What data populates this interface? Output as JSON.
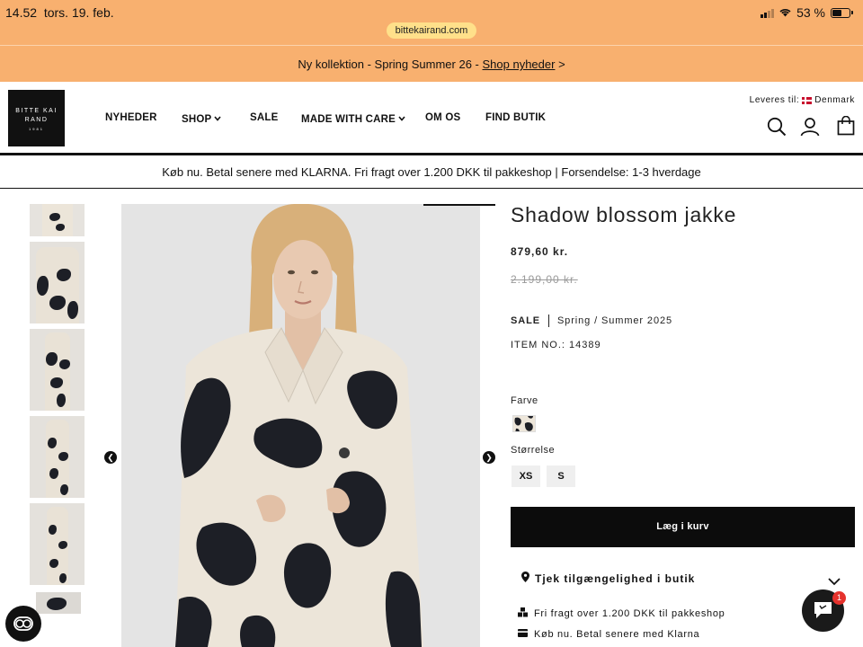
{
  "status_bar": {
    "time": "14.52",
    "date": "tors. 19. feb.",
    "battery": "53 %",
    "battery_level": 0.53,
    "url": "bittekairand.com"
  },
  "promo": {
    "text": "Ny kollektion - Spring Summer 26 - ",
    "link": "Shop nyheder",
    "arrow": " >"
  },
  "header": {
    "logo_line1": "BITTE KAI",
    "logo_line2": "RAND",
    "logo_year": "1981",
    "nav": [
      {
        "label": "NYHEDER"
      },
      {
        "label": "SHOP"
      },
      {
        "label": "SALE"
      },
      {
        "label": "MADE WITH CARE"
      },
      {
        "label": "OM OS"
      },
      {
        "label": "FIND BUTIK"
      }
    ],
    "delivery_label": "Leveres til:",
    "delivery_country": "Denmark"
  },
  "info_bar": "Køb nu. Betal senere med KLARNA. Fri fragt over 1.200 DKK til pakkeshop | Forsendelse: 1-3 hverdage",
  "product": {
    "title": "Shadow blossom jakke",
    "price": "879,60 kr.",
    "old_price": "2.199,00 kr.",
    "sale_tag": "SALE",
    "season": "Spring / Summer 2025",
    "item_no": "ITEM NO.: 14389",
    "color_label": "Farve",
    "size_label": "Størrelse",
    "sizes": [
      "XS",
      "S"
    ],
    "add_to_cart": "Læg i kurv",
    "store_check": "Tjek tilgængelighed i butik",
    "perks": [
      "Fri fragt over 1.200 DKK til pakkeshop",
      "Køb nu. Betal senere med Klarna"
    ]
  },
  "chat": {
    "badge": "1"
  }
}
